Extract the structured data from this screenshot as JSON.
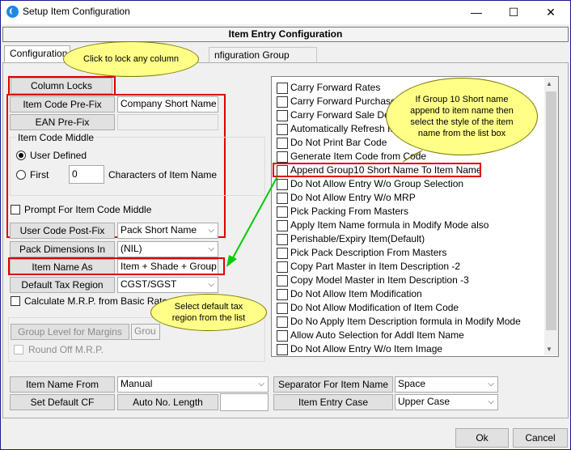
{
  "window": {
    "title": "Setup Item Configuration",
    "minimize_glyph": "—",
    "maximize_glyph": "☐",
    "close_glyph": "✕"
  },
  "header": {
    "title": "Item Entry Configuration"
  },
  "tabs": [
    {
      "label": "Configuration Op"
    },
    {
      "label": "nfiguration Group Settings"
    }
  ],
  "left": {
    "column_locks_label": "Column Locks",
    "item_code_prefix": {
      "label": "Item Code Pre-Fix",
      "value": "Company Short Name"
    },
    "ean_prefix": {
      "label": "EAN Pre-Fix",
      "value": ""
    },
    "item_code_middle": {
      "title": "Item Code Middle",
      "user_defined_label": "User Defined",
      "first_label": "First",
      "first_value": "0",
      "chars_label": "Characters of Item Name"
    },
    "prompt_label": "Prompt For Item Code Middle",
    "user_code_postfix": {
      "label": "User Code Post-Fix",
      "value": "Pack Short Name"
    },
    "pack_dimensions": {
      "label": "Pack Dimensions In",
      "value": "(NIL)"
    },
    "item_name_as": {
      "label": "Item Name As",
      "value": "Item + Shade + Group"
    },
    "default_tax_region": {
      "label": "Default Tax Region",
      "value": "CGST/SGST"
    },
    "calc_mrp_label": "Calculate M.R.P. from Basic Rate+G",
    "group_level_label": "Group Level for Margins",
    "group_level_value": "Grou",
    "round_off_label": "Round Off M.R.P."
  },
  "list": {
    "items": [
      "Carry Forward Rates",
      "Carry Forward Purchase",
      "Carry Forward Sale Defa",
      "Automatically Refresh Ite",
      "Do Not Print Bar Code",
      "Generate Item Code from Code",
      "Append Group10 Short Name To Item Name",
      "Do Not Allow Entry W/o Group Selection",
      "Do Not Allow Entry W/o MRP",
      "Pick Packing From Masters",
      "Apply Item Name formula in Modify Mode also",
      "Perishable/Expiry Item(Default)",
      "Pick Pack Description From Masters",
      "Copy Part Master in Item Description -2",
      "Copy Model Master in Item Description -3",
      "Do Not Allow Item Modification",
      "Do Not Allow Modification of Item Code",
      "Do No Apply Item Description formula in Modify Mode",
      "Allow Auto Selection for Addl Item Name",
      "Do Not Allow Entry W/o Item Image"
    ],
    "scroll_up_glyph": "▲",
    "scroll_down_glyph": "▼"
  },
  "bottom": {
    "item_name_from": {
      "label": "Item Name From",
      "value": "Manual"
    },
    "set_default_cf_label": "Set Default CF",
    "auto_no_length": {
      "label": "Auto No. Length",
      "value": ""
    },
    "separator": {
      "label": "Separator For Item Name",
      "value": "Space"
    },
    "item_entry_case": {
      "label": "Item Entry Case",
      "value": "Upper Case"
    }
  },
  "footer": {
    "ok_label": "Ok",
    "cancel_label": "Cancel"
  },
  "callouts": {
    "lock": "Click to lock any column",
    "group10": "If Group 10 Short name append to item name then select the style of the item name from the list box",
    "tax": "Select default tax region from the list"
  },
  "colors": {
    "highlight": "#e00000",
    "callout": "#ffff88",
    "arrow": "#00cc00"
  }
}
